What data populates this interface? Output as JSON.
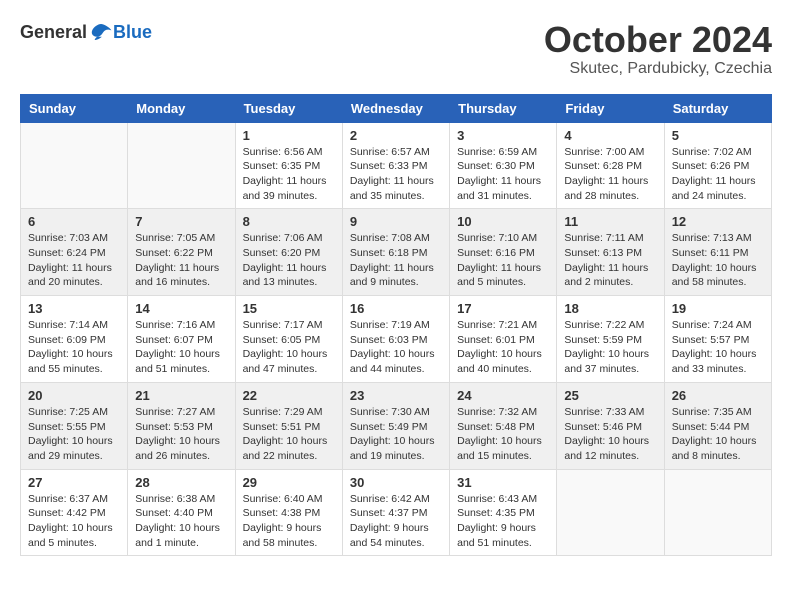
{
  "header": {
    "logo_general": "General",
    "logo_blue": "Blue",
    "month": "October 2024",
    "location": "Skutec, Pardubicky, Czechia"
  },
  "weekdays": [
    "Sunday",
    "Monday",
    "Tuesday",
    "Wednesday",
    "Thursday",
    "Friday",
    "Saturday"
  ],
  "weeks": [
    [
      {
        "day": "",
        "info": ""
      },
      {
        "day": "",
        "info": ""
      },
      {
        "day": "1",
        "info": "Sunrise: 6:56 AM\nSunset: 6:35 PM\nDaylight: 11 hours and 39 minutes."
      },
      {
        "day": "2",
        "info": "Sunrise: 6:57 AM\nSunset: 6:33 PM\nDaylight: 11 hours and 35 minutes."
      },
      {
        "day": "3",
        "info": "Sunrise: 6:59 AM\nSunset: 6:30 PM\nDaylight: 11 hours and 31 minutes."
      },
      {
        "day": "4",
        "info": "Sunrise: 7:00 AM\nSunset: 6:28 PM\nDaylight: 11 hours and 28 minutes."
      },
      {
        "day": "5",
        "info": "Sunrise: 7:02 AM\nSunset: 6:26 PM\nDaylight: 11 hours and 24 minutes."
      }
    ],
    [
      {
        "day": "6",
        "info": "Sunrise: 7:03 AM\nSunset: 6:24 PM\nDaylight: 11 hours and 20 minutes."
      },
      {
        "day": "7",
        "info": "Sunrise: 7:05 AM\nSunset: 6:22 PM\nDaylight: 11 hours and 16 minutes."
      },
      {
        "day": "8",
        "info": "Sunrise: 7:06 AM\nSunset: 6:20 PM\nDaylight: 11 hours and 13 minutes."
      },
      {
        "day": "9",
        "info": "Sunrise: 7:08 AM\nSunset: 6:18 PM\nDaylight: 11 hours and 9 minutes."
      },
      {
        "day": "10",
        "info": "Sunrise: 7:10 AM\nSunset: 6:16 PM\nDaylight: 11 hours and 5 minutes."
      },
      {
        "day": "11",
        "info": "Sunrise: 7:11 AM\nSunset: 6:13 PM\nDaylight: 11 hours and 2 minutes."
      },
      {
        "day": "12",
        "info": "Sunrise: 7:13 AM\nSunset: 6:11 PM\nDaylight: 10 hours and 58 minutes."
      }
    ],
    [
      {
        "day": "13",
        "info": "Sunrise: 7:14 AM\nSunset: 6:09 PM\nDaylight: 10 hours and 55 minutes."
      },
      {
        "day": "14",
        "info": "Sunrise: 7:16 AM\nSunset: 6:07 PM\nDaylight: 10 hours and 51 minutes."
      },
      {
        "day": "15",
        "info": "Sunrise: 7:17 AM\nSunset: 6:05 PM\nDaylight: 10 hours and 47 minutes."
      },
      {
        "day": "16",
        "info": "Sunrise: 7:19 AM\nSunset: 6:03 PM\nDaylight: 10 hours and 44 minutes."
      },
      {
        "day": "17",
        "info": "Sunrise: 7:21 AM\nSunset: 6:01 PM\nDaylight: 10 hours and 40 minutes."
      },
      {
        "day": "18",
        "info": "Sunrise: 7:22 AM\nSunset: 5:59 PM\nDaylight: 10 hours and 37 minutes."
      },
      {
        "day": "19",
        "info": "Sunrise: 7:24 AM\nSunset: 5:57 PM\nDaylight: 10 hours and 33 minutes."
      }
    ],
    [
      {
        "day": "20",
        "info": "Sunrise: 7:25 AM\nSunset: 5:55 PM\nDaylight: 10 hours and 29 minutes."
      },
      {
        "day": "21",
        "info": "Sunrise: 7:27 AM\nSunset: 5:53 PM\nDaylight: 10 hours and 26 minutes."
      },
      {
        "day": "22",
        "info": "Sunrise: 7:29 AM\nSunset: 5:51 PM\nDaylight: 10 hours and 22 minutes."
      },
      {
        "day": "23",
        "info": "Sunrise: 7:30 AM\nSunset: 5:49 PM\nDaylight: 10 hours and 19 minutes."
      },
      {
        "day": "24",
        "info": "Sunrise: 7:32 AM\nSunset: 5:48 PM\nDaylight: 10 hours and 15 minutes."
      },
      {
        "day": "25",
        "info": "Sunrise: 7:33 AM\nSunset: 5:46 PM\nDaylight: 10 hours and 12 minutes."
      },
      {
        "day": "26",
        "info": "Sunrise: 7:35 AM\nSunset: 5:44 PM\nDaylight: 10 hours and 8 minutes."
      }
    ],
    [
      {
        "day": "27",
        "info": "Sunrise: 6:37 AM\nSunset: 4:42 PM\nDaylight: 10 hours and 5 minutes."
      },
      {
        "day": "28",
        "info": "Sunrise: 6:38 AM\nSunset: 4:40 PM\nDaylight: 10 hours and 1 minute."
      },
      {
        "day": "29",
        "info": "Sunrise: 6:40 AM\nSunset: 4:38 PM\nDaylight: 9 hours and 58 minutes."
      },
      {
        "day": "30",
        "info": "Sunrise: 6:42 AM\nSunset: 4:37 PM\nDaylight: 9 hours and 54 minutes."
      },
      {
        "day": "31",
        "info": "Sunrise: 6:43 AM\nSunset: 4:35 PM\nDaylight: 9 hours and 51 minutes."
      },
      {
        "day": "",
        "info": ""
      },
      {
        "day": "",
        "info": ""
      }
    ]
  ]
}
